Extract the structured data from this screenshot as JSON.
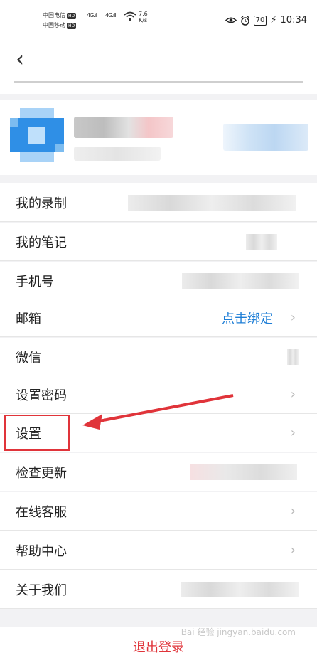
{
  "status_bar": {
    "carrier1": "中国电信",
    "carrier2": "中国移动",
    "hd": "HD",
    "network": "4G",
    "speed_value": "7.6",
    "speed_unit": "K/s",
    "battery": "70",
    "time": "10:34"
  },
  "menu": [
    {
      "label": "我的录制"
    },
    {
      "label": "我的笔记"
    },
    {
      "label": "手机号"
    },
    {
      "label": "邮箱",
      "action": "点击绑定"
    },
    {
      "label": "微信"
    },
    {
      "label": "设置密码"
    },
    {
      "label": "设置"
    },
    {
      "label": "检查更新"
    },
    {
      "label": "在线客服"
    },
    {
      "label": "帮助中心"
    },
    {
      "label": "关于我们"
    }
  ],
  "logout": "退出登录",
  "watermark": "Bai 经验 jingyan.baidu.com",
  "colors": {
    "accent_link": "#1e7ed6",
    "highlight_red": "#e0343a",
    "avatar_blue": "#2f8fe6"
  }
}
